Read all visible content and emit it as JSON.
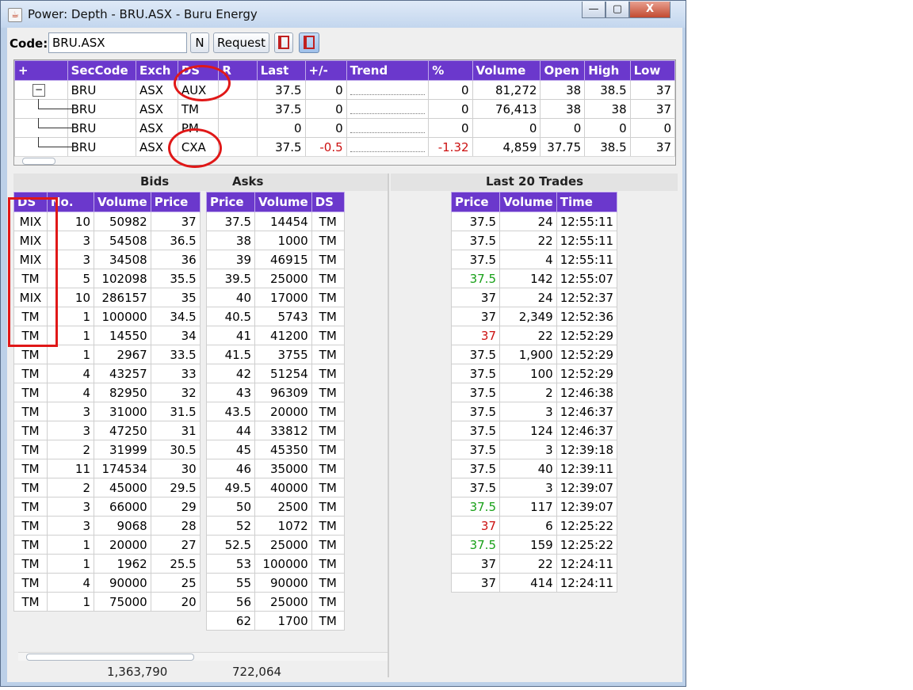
{
  "window": {
    "title": "Power: Depth - BRU.ASX - Buru Energy",
    "buttons": {
      "minimize": "—",
      "maximize": "▢",
      "close": "X"
    }
  },
  "toolbar": {
    "code_label": "Code:",
    "code_value": "BRU.ASX",
    "n_label": "N",
    "request_label": "Request"
  },
  "summary": {
    "headers": [
      "+",
      "SecCode",
      "Exch",
      "DS",
      "R",
      "Last",
      "+/-",
      "Trend",
      "%",
      "Volume",
      "Open",
      "High",
      "Low"
    ],
    "rows": [
      {
        "sec": "BRU",
        "exch": "ASX",
        "ds": "AUX",
        "r": "",
        "last": "37.5",
        "chg": "0",
        "pct": "0",
        "vol": "81,272",
        "open": "38",
        "high": "38.5",
        "low": "37",
        "neg": false
      },
      {
        "sec": "BRU",
        "exch": "ASX",
        "ds": "TM",
        "r": "",
        "last": "37.5",
        "chg": "0",
        "pct": "0",
        "vol": "76,413",
        "open": "38",
        "high": "38",
        "low": "37",
        "neg": false
      },
      {
        "sec": "BRU",
        "exch": "ASX",
        "ds": "PM",
        "r": "",
        "last": "0",
        "chg": "0",
        "pct": "0",
        "vol": "0",
        "open": "0",
        "high": "0",
        "low": "0",
        "neg": false
      },
      {
        "sec": "BRU",
        "exch": "ASX",
        "ds": "CXA",
        "r": "",
        "last": "37.5",
        "chg": "-0.5",
        "pct": "-1.32",
        "vol": "4,859",
        "open": "37.75",
        "high": "38.5",
        "low": "37",
        "neg": true
      }
    ]
  },
  "bids": {
    "title": "Bids",
    "headers": [
      "DS",
      "No.",
      "Volume",
      "Price"
    ],
    "rows": [
      [
        "MIX",
        "10",
        "50982",
        "37"
      ],
      [
        "MIX",
        "3",
        "54508",
        "36.5"
      ],
      [
        "MIX",
        "3",
        "34508",
        "36"
      ],
      [
        "TM",
        "5",
        "102098",
        "35.5"
      ],
      [
        "MIX",
        "10",
        "286157",
        "35"
      ],
      [
        "TM",
        "1",
        "100000",
        "34.5"
      ],
      [
        "TM",
        "1",
        "14550",
        "34"
      ],
      [
        "TM",
        "1",
        "2967",
        "33.5"
      ],
      [
        "TM",
        "4",
        "43257",
        "33"
      ],
      [
        "TM",
        "4",
        "82950",
        "32"
      ],
      [
        "TM",
        "3",
        "31000",
        "31.5"
      ],
      [
        "TM",
        "3",
        "47250",
        "31"
      ],
      [
        "TM",
        "2",
        "31999",
        "30.5"
      ],
      [
        "TM",
        "11",
        "174534",
        "30"
      ],
      [
        "TM",
        "2",
        "45000",
        "29.5"
      ],
      [
        "TM",
        "3",
        "66000",
        "29"
      ],
      [
        "TM",
        "3",
        "9068",
        "28"
      ],
      [
        "TM",
        "1",
        "20000",
        "27"
      ],
      [
        "TM",
        "1",
        "1962",
        "25.5"
      ],
      [
        "TM",
        "4",
        "90000",
        "25"
      ],
      [
        "TM",
        "1",
        "75000",
        "20"
      ]
    ],
    "total": "1,363,790"
  },
  "asks": {
    "title": "Asks",
    "headers": [
      "Price",
      "Volume",
      "DS"
    ],
    "rows": [
      [
        "37.5",
        "14454",
        "TM"
      ],
      [
        "38",
        "1000",
        "TM"
      ],
      [
        "39",
        "46915",
        "TM"
      ],
      [
        "39.5",
        "25000",
        "TM"
      ],
      [
        "40",
        "17000",
        "TM"
      ],
      [
        "40.5",
        "5743",
        "TM"
      ],
      [
        "41",
        "41200",
        "TM"
      ],
      [
        "41.5",
        "3755",
        "TM"
      ],
      [
        "42",
        "51254",
        "TM"
      ],
      [
        "43",
        "96309",
        "TM"
      ],
      [
        "43.5",
        "20000",
        "TM"
      ],
      [
        "44",
        "33812",
        "TM"
      ],
      [
        "45",
        "45350",
        "TM"
      ],
      [
        "46",
        "35000",
        "TM"
      ],
      [
        "49.5",
        "40000",
        "TM"
      ],
      [
        "50",
        "2500",
        "TM"
      ],
      [
        "52",
        "1072",
        "TM"
      ],
      [
        "52.5",
        "25000",
        "TM"
      ],
      [
        "53",
        "100000",
        "TM"
      ],
      [
        "55",
        "90000",
        "TM"
      ],
      [
        "56",
        "25000",
        "TM"
      ],
      [
        "62",
        "1700",
        "TM"
      ]
    ],
    "total": "722,064"
  },
  "trades": {
    "title": "Last 20 Trades",
    "headers": [
      "Price",
      "Volume",
      "Time"
    ],
    "rows": [
      {
        "p": "37.5",
        "v": "24",
        "t": "12:55:11",
        "c": ""
      },
      {
        "p": "37.5",
        "v": "22",
        "t": "12:55:11",
        "c": ""
      },
      {
        "p": "37.5",
        "v": "4",
        "t": "12:55:11",
        "c": ""
      },
      {
        "p": "37.5",
        "v": "142",
        "t": "12:55:07",
        "c": "pos"
      },
      {
        "p": "37",
        "v": "24",
        "t": "12:52:37",
        "c": ""
      },
      {
        "p": "37",
        "v": "2,349",
        "t": "12:52:36",
        "c": ""
      },
      {
        "p": "37",
        "v": "22",
        "t": "12:52:29",
        "c": "neg"
      },
      {
        "p": "37.5",
        "v": "1,900",
        "t": "12:52:29",
        "c": ""
      },
      {
        "p": "37.5",
        "v": "100",
        "t": "12:52:29",
        "c": ""
      },
      {
        "p": "37.5",
        "v": "2",
        "t": "12:46:38",
        "c": ""
      },
      {
        "p": "37.5",
        "v": "3",
        "t": "12:46:37",
        "c": ""
      },
      {
        "p": "37.5",
        "v": "124",
        "t": "12:46:37",
        "c": ""
      },
      {
        "p": "37.5",
        "v": "3",
        "t": "12:39:18",
        "c": ""
      },
      {
        "p": "37.5",
        "v": "40",
        "t": "12:39:11",
        "c": ""
      },
      {
        "p": "37.5",
        "v": "3",
        "t": "12:39:07",
        "c": ""
      },
      {
        "p": "37.5",
        "v": "117",
        "t": "12:39:07",
        "c": "pos"
      },
      {
        "p": "37",
        "v": "6",
        "t": "12:25:22",
        "c": "neg"
      },
      {
        "p": "37.5",
        "v": "159",
        "t": "12:25:22",
        "c": "pos"
      },
      {
        "p": "37",
        "v": "22",
        "t": "12:24:11",
        "c": ""
      },
      {
        "p": "37",
        "v": "414",
        "t": "12:24:11",
        "c": ""
      }
    ]
  },
  "colors": {
    "header_bg": "#6b38cc",
    "negative": "#cc1010",
    "positive": "#18a018",
    "annotation": "#e01818"
  }
}
